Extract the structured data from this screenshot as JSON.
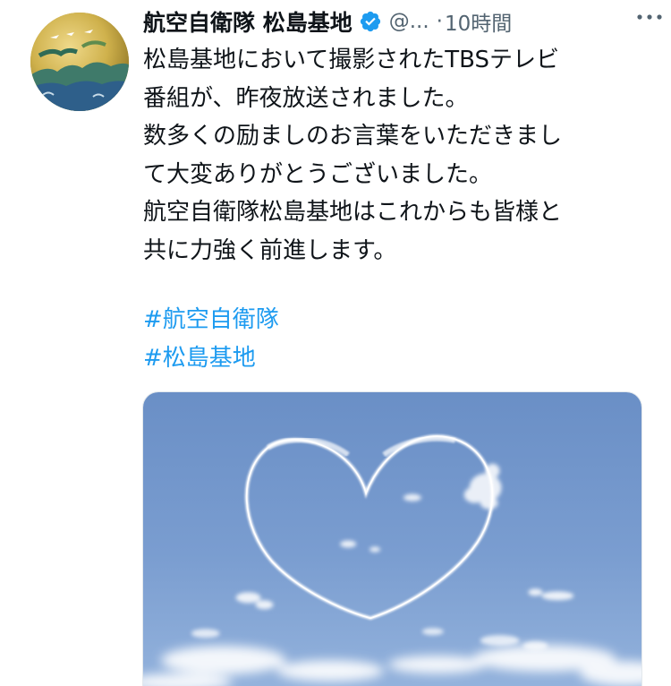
{
  "tweet": {
    "author": {
      "display_name": "航空自衛隊 松島基地",
      "handle": "@...",
      "avatar_icon": "avatar-icon",
      "verified_icon": "verified-badge-icon"
    },
    "separator": "·",
    "timestamp": "10時間",
    "more_icon": "more-options-icon",
    "text_lines": [
      "松島基地において撮影されたTBSテレビ",
      "番組が、昨夜放送されました。",
      "数多くの励ましのお言葉をいただきまし",
      "て大変ありがとうございました。",
      "航空自衛隊松島基地はこれからも皆様と",
      "共に力強く前進します。"
    ],
    "hashtags": [
      "#航空自衛隊",
      "#松島基地"
    ],
    "media": {
      "kind": "photo",
      "subject_icon": "heart-skywriting-photo"
    }
  },
  "colors": {
    "text": "#0f1419",
    "secondary": "#536471",
    "link": "#1d9bf0",
    "verified": "#1d9bf0",
    "sky": "#6f93c8"
  }
}
